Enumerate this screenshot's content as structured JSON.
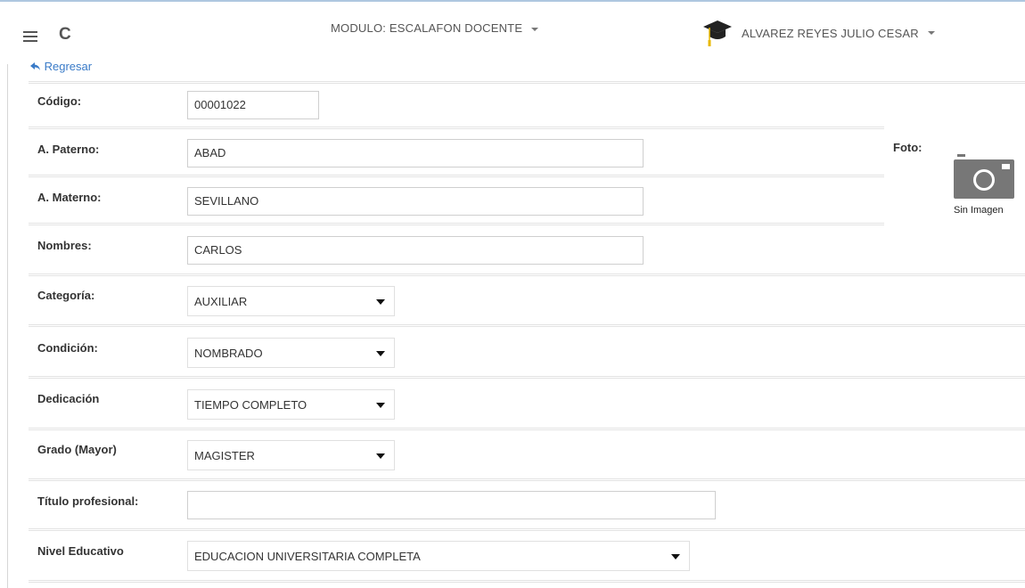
{
  "header": {
    "module_label": "MODULO: ESCALAFON DOCENTE",
    "user_name": "ALVAREZ REYES JULIO CESAR"
  },
  "nav": {
    "back_label": "Regresar"
  },
  "form": {
    "codigo": {
      "label": "Código:",
      "value": "00001022"
    },
    "paterno": {
      "label": "A. Paterno:",
      "value": "ABAD"
    },
    "materno": {
      "label": "A. Materno:",
      "value": "SEVILLANO"
    },
    "nombres": {
      "label": "Nombres:",
      "value": "CARLOS"
    },
    "categoria": {
      "label": "Categoría:",
      "value": "AUXILIAR"
    },
    "condicion": {
      "label": "Condición:",
      "value": "NOMBRADO"
    },
    "dedicacion": {
      "label": "Dedicación",
      "value": "TIEMPO COMPLETO"
    },
    "grado": {
      "label": "Grado (Mayor)",
      "value": "MAGISTER"
    },
    "titulo": {
      "label": "Título profesional:",
      "value": ""
    },
    "nivel": {
      "label": "Nivel Educativo",
      "value": "EDUCACION UNIVERSITARIA COMPLETA"
    }
  },
  "photo": {
    "label": "Foto:",
    "caption": "Sin Imagen"
  },
  "icons": {
    "menu": "hamburger-icon",
    "refresh": "refresh-icon",
    "user": "graduation-cap-icon",
    "back": "reply-arrow-icon",
    "photo": "camera-icon"
  },
  "colors": {
    "link": "#3a7bc8",
    "cap_tassel": "#e8b800"
  }
}
